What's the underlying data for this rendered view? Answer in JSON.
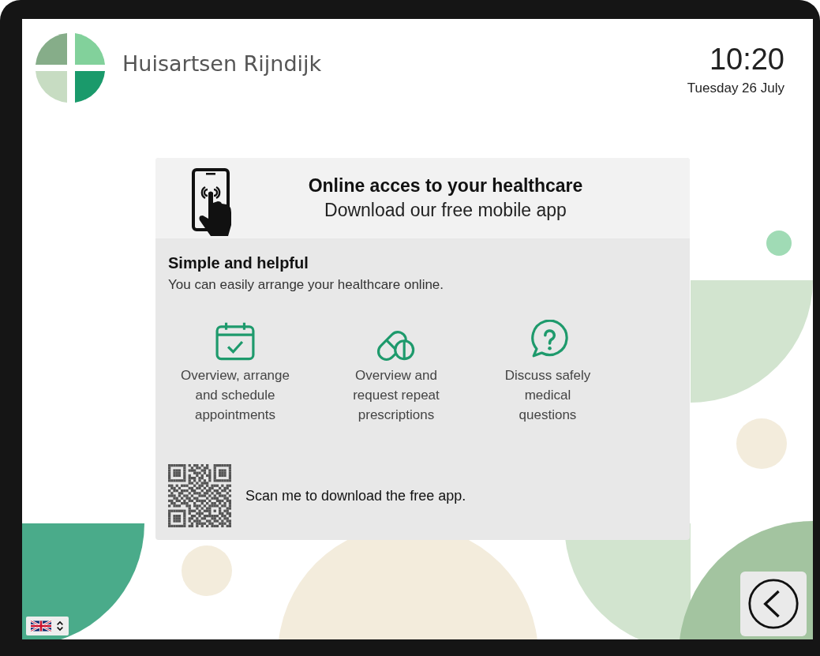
{
  "header": {
    "title": "Huisartsen Rijndijk",
    "time": "10:20",
    "date": "Tuesday 26 July"
  },
  "card": {
    "heading": "Online acces to your healthcare",
    "subheading": "Download our free mobile app",
    "section_title": "Simple and helpful",
    "section_text": "You can easily arrange your healthcare online.",
    "features": [
      {
        "kind": "calendar",
        "label": "Overview, arrange\nand schedule\nappointments"
      },
      {
        "kind": "pills",
        "label": "Overview and\nrequest repeat\nprescriptions"
      },
      {
        "kind": "question",
        "label": "Discuss safely\nmedical\nquestions"
      }
    ],
    "qr_caption": "Scan me to download the free app."
  }
}
